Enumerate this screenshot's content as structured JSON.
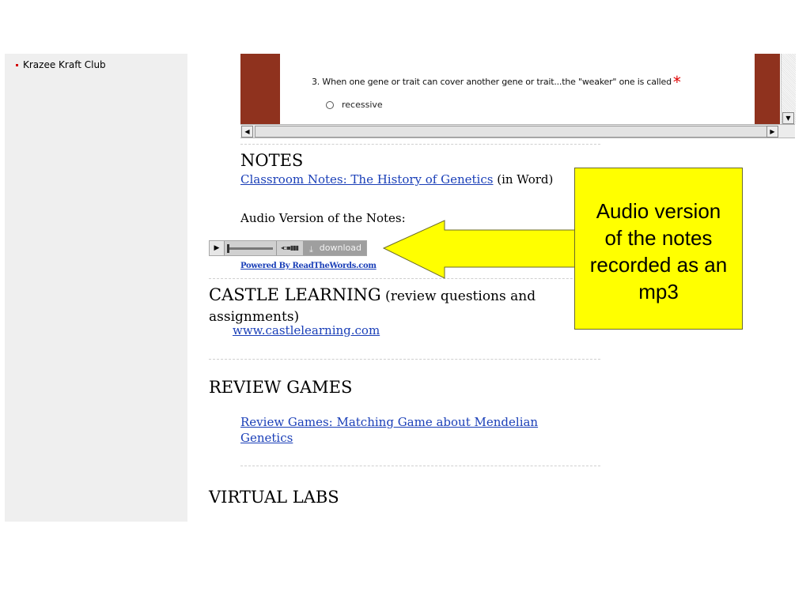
{
  "sidebar": {
    "items": [
      {
        "label": "Krazee Kraft Club"
      }
    ]
  },
  "quiz_frame": {
    "question": "3. When one gene or trait can cover another gene or trait...the \"weaker\" one is called",
    "required_mark": "*",
    "option": "recessive",
    "colors": {
      "band": "#8f321e"
    }
  },
  "notes": {
    "title": "NOTES",
    "link": "Classroom Notes: The History of Genetics",
    "link_suffix": " (in Word)",
    "audio_label": "Audio Version of the Notes:",
    "player": {
      "download_label": "download"
    },
    "powered_by": "Powered By ReadTheWords.com"
  },
  "castle": {
    "title": "CASTLE LEARNING",
    "subtitle_line1": " (review questions and",
    "subtitle_line2": "assignments)",
    "link": "www.castlelearning.com"
  },
  "review_games": {
    "title": "REVIEW GAMES",
    "link_line1": "Review Games: Matching Game about Mendelian",
    "link_line2": "Genetics"
  },
  "virtual_labs": {
    "title": "VIRTUAL LABS"
  },
  "callout": {
    "lines": [
      "Audio version",
      "of the notes",
      "recorded as an",
      "mp3"
    ],
    "colors": {
      "fill": "#ffff00"
    }
  },
  "icons": [
    "bullet-icon",
    "radio-icon",
    "play-icon",
    "volume-icon",
    "download-icon",
    "scroll-left-icon",
    "scroll-right-icon",
    "scroll-down-icon",
    "callout-arrow-icon"
  ]
}
